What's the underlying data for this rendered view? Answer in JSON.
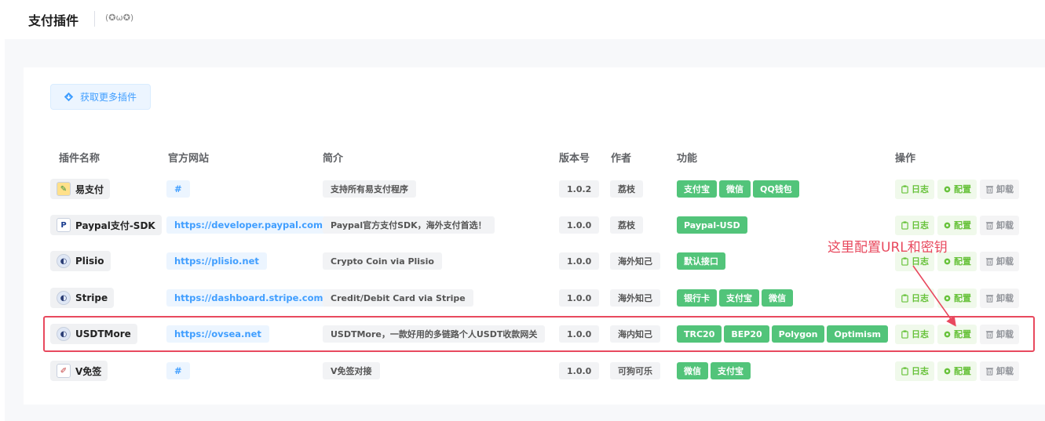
{
  "header": {
    "title": "支付插件",
    "face": "(✪ω✪)"
  },
  "more_button": "获取更多插件",
  "columns": {
    "name": "插件名称",
    "site": "官方网站",
    "desc": "简介",
    "version": "版本号",
    "author": "作者",
    "features": "功能",
    "actions": "操作"
  },
  "actions": {
    "log": "日志",
    "config": "配置",
    "uninstall": "卸载"
  },
  "colors": {
    "accent": "#409eff",
    "tag_green": "#52c47a",
    "annotation": "#e8495e"
  },
  "rows": [
    {
      "name": "易支付",
      "logo": "yi-pay-logo",
      "site": "#",
      "desc": "支持所有易支付程序",
      "version": "1.0.2",
      "author": "荔枝",
      "features": [
        "支付宝",
        "微信",
        "QQ钱包"
      ]
    },
    {
      "name": "Paypal支付-SDK",
      "logo": "paypal-logo",
      "site": "https://developer.paypal.com",
      "desc": "Paypal官方支付SDK，海外支付首选！",
      "version": "1.0.0",
      "author": "荔枝",
      "features": [
        "Paypal-USD"
      ]
    },
    {
      "name": "Plisio",
      "logo": "plisio-logo",
      "site": "https://plisio.net",
      "desc": "Crypto Coin via Plisio",
      "version": "1.0.0",
      "author": "海外知己",
      "features": [
        "默认接口"
      ]
    },
    {
      "name": "Stripe",
      "logo": "stripe-logo",
      "site": "https://dashboard.stripe.com",
      "desc": "Credit/Debit Card via Stripe",
      "version": "1.0.0",
      "author": "海外知己",
      "features": [
        "银行卡",
        "支付宝",
        "微信"
      ]
    },
    {
      "name": "USDTMore",
      "logo": "usdtmore-logo",
      "site": "https://ovsea.net",
      "desc": "USDTMore，一款好用的多链路个人USDT收款网关",
      "version": "1.0.0",
      "author": "海内知己",
      "features": [
        "TRC20",
        "BEP20",
        "Polygon",
        "Optimism"
      ]
    },
    {
      "name": "V免签",
      "logo": "v-mianqian-logo",
      "site": "#",
      "desc": "V免签对接",
      "version": "1.0.0",
      "author": "可狗可乐",
      "features": [
        "微信",
        "支付宝"
      ]
    }
  ],
  "annotation": "这里配置URL和密钥"
}
